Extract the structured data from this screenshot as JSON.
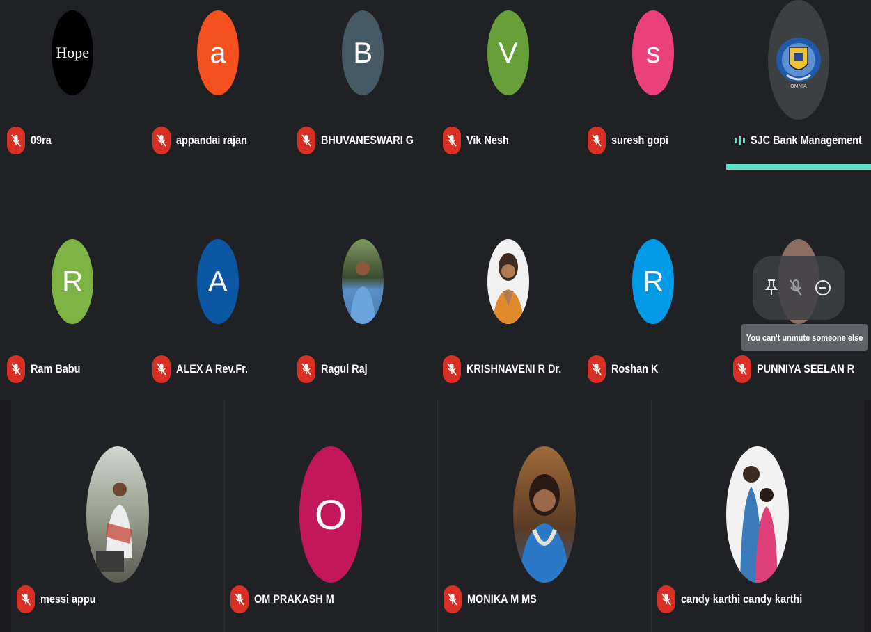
{
  "row1": [
    {
      "name": "09ra",
      "avatar_type": "logo",
      "logo_text": "Hope",
      "color": "#000000"
    },
    {
      "name": "appandai rajan",
      "initial": "a",
      "color": "#f4511e"
    },
    {
      "name": "BHUVANESWARI G",
      "initial": "B",
      "color": "#455a64"
    },
    {
      "name": "Vik Nesh",
      "initial": "V",
      "color": "#689f38"
    },
    {
      "name": "suresh gopi",
      "initial": "s",
      "color": "#ec407a"
    },
    {
      "name": "SJC Bank Management",
      "avatar_type": "logo",
      "logo_text": "OMNIA",
      "speaking": true
    }
  ],
  "row2": [
    {
      "name": "Ram Babu",
      "initial": "R",
      "color": "#7cb342"
    },
    {
      "name": "ALEX A Rev.Fr.",
      "initial": "A",
      "color": "#0b57a4"
    },
    {
      "name": "Ragul Raj",
      "avatar_type": "photo",
      "color": "#6a8a5a"
    },
    {
      "name": "KRISHNAVENI R Dr.",
      "avatar_type": "photo",
      "color": "#c98a5a"
    },
    {
      "name": "Roshan K",
      "initial": "R",
      "color": "#039be5"
    },
    {
      "name": "PUNNIYA SEELAN R",
      "avatar_type": "photo",
      "color": "#8d6e63"
    }
  ],
  "row3": [
    {
      "name": "messi appu",
      "avatar_type": "photo",
      "color": "#8a8f7a"
    },
    {
      "name": "OM PRAKASH M",
      "initial": "O",
      "color": "#c2185b"
    },
    {
      "name": "MONIKA M MS",
      "avatar_type": "photo",
      "color": "#5a4a3a"
    },
    {
      "name": "candy karthi candy karthi",
      "avatar_type": "photo",
      "color": "#b0406a"
    }
  ],
  "tooltip": "You can't unmute someone else",
  "colors": {
    "muted": "#d93025",
    "speaking": "#5ce0c6",
    "tile_bg": "#202124"
  }
}
